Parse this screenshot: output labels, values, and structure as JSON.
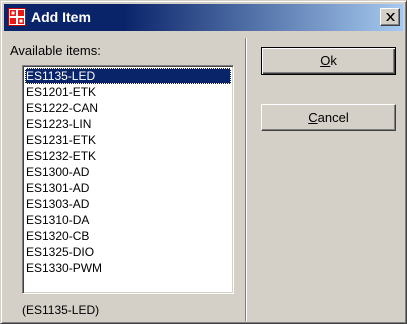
{
  "window": {
    "title": "Add Item",
    "title_icon": "add-item-app-icon",
    "close_icon": "close-icon",
    "titlebar_color": "#0a246a"
  },
  "left_pane": {
    "label": "Available items:",
    "items": [
      "ES1135-LED",
      "ES1201-ETK",
      "ES1222-CAN",
      "ES1223-LIN",
      "ES1231-ETK",
      "ES1232-ETK",
      "ES1300-AD",
      "ES1301-AD",
      "ES1303-AD",
      "ES1310-DA",
      "ES1320-CB",
      "ES1325-DIO",
      "ES1330-PWM"
    ],
    "selected_index": 0,
    "selection_status": "(ES1135-LED)"
  },
  "buttons": {
    "ok": {
      "mnemonic": "O",
      "rest": "k"
    },
    "cancel": {
      "mnemonic": "C",
      "rest": "ancel"
    }
  }
}
